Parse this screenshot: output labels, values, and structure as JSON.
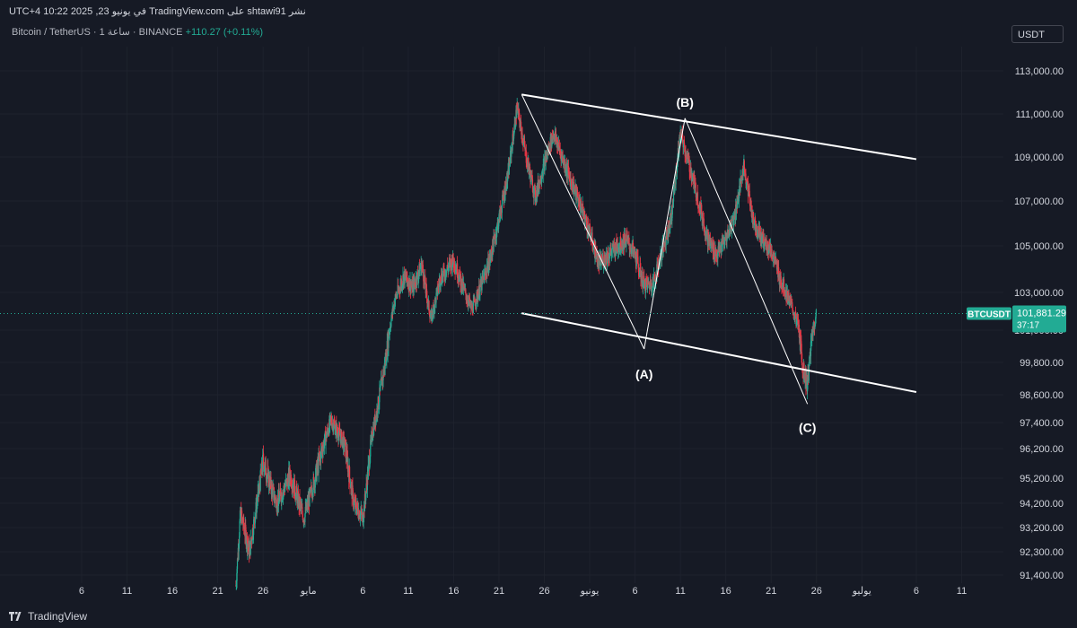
{
  "header": {
    "publisher_line": "نشر shtawi91 على TradingView.com في يونيو 23, 2025 10:22 UTC+4",
    "symbol": "Bitcoin / TetherUS · 1 ساعة · BINANCE",
    "change": "+110.27 (+0.11%)",
    "currency_button": "USDT"
  },
  "footer": {
    "brand": "TradingView"
  },
  "colors": {
    "background": "#161a25",
    "up": "#22ab94",
    "down": "#f23645",
    "price_tag": "#22ab94",
    "annotation": "#ffffff"
  },
  "chart_data": {
    "type": "candlestick",
    "symbol": "BTCUSDT",
    "last_price": "101,881.29",
    "countdown": "37:17",
    "ylim": [
      90800,
      114600
    ],
    "y_ticks": [
      "113,000.00",
      "111,000.00",
      "109,000.00",
      "107,000.00",
      "105,000.00",
      "103,000.00",
      "101,000.00",
      "99,800.00",
      "98,600.00",
      "97,400.00",
      "96,200.00",
      "95,200.00",
      "94,200.00",
      "93,200.00",
      "92,300.00",
      "91,400.00"
    ],
    "y_tick_values": [
      113000,
      111000,
      109000,
      107000,
      105000,
      103000,
      101000,
      99800,
      98600,
      97400,
      96200,
      95200,
      94200,
      93200,
      92300,
      91400
    ],
    "x_ticks": [
      "6",
      "11",
      "16",
      "21",
      "26",
      "مايو",
      "6",
      "11",
      "16",
      "21",
      "26",
      "يونيو",
      "6",
      "11",
      "16",
      "21",
      "26",
      "يوليو",
      "6",
      "11"
    ],
    "x_tick_days": [
      6,
      11,
      16,
      21,
      26,
      31,
      37,
      42,
      47,
      52,
      57,
      62,
      67,
      72,
      77,
      82,
      87,
      92,
      98,
      103
    ],
    "note_x": "x values are days counted from April 1 (1 = April 1, 31 = May 1, 62 = June 1, 92 = July 1)",
    "price_path": [
      [
        23,
        91000
      ],
      [
        23.5,
        93800
      ],
      [
        24.5,
        92300
      ],
      [
        26,
        95800
      ],
      [
        27.5,
        94200
      ],
      [
        29,
        95300
      ],
      [
        30.5,
        93600
      ],
      [
        32.5,
        96200
      ],
      [
        33.5,
        97500
      ],
      [
        35,
        96400
      ],
      [
        36,
        94200
      ],
      [
        37,
        93600
      ],
      [
        38,
        96800
      ],
      [
        39.5,
        99900
      ],
      [
        40.5,
        102600
      ],
      [
        41.5,
        103700
      ],
      [
        42.5,
        103200
      ],
      [
        43.5,
        104200
      ],
      [
        44.5,
        101600
      ],
      [
        45.5,
        103600
      ],
      [
        47,
        104400
      ],
      [
        49,
        102100
      ],
      [
        51,
        104400
      ],
      [
        52,
        106200
      ],
      [
        53,
        108200
      ],
      [
        54,
        111300
      ],
      [
        55,
        109000
      ],
      [
        56,
        107200
      ],
      [
        57,
        108700
      ],
      [
        58,
        110100
      ],
      [
        59.5,
        108400
      ],
      [
        61,
        106800
      ],
      [
        62,
        105600
      ],
      [
        63,
        104200
      ],
      [
        64.5,
        104800
      ],
      [
        66,
        105300
      ],
      [
        67,
        104600
      ],
      [
        68,
        103300
      ],
      [
        69,
        103400
      ],
      [
        70,
        104800
      ],
      [
        71,
        106300
      ],
      [
        72,
        110100
      ],
      [
        73.5,
        107800
      ],
      [
        75,
        105300
      ],
      [
        76,
        104600
      ],
      [
        77,
        105300
      ],
      [
        78,
        106400
      ],
      [
        79,
        108600
      ],
      [
        80,
        106200
      ],
      [
        81,
        105300
      ],
      [
        82,
        104800
      ],
      [
        83,
        103600
      ],
      [
        84,
        102600
      ],
      [
        85,
        101200
      ],
      [
        85.5,
        99600
      ],
      [
        86,
        99000
      ],
      [
        86.5,
        100800
      ],
      [
        87,
        101900
      ]
    ],
    "lines": [
      {
        "name": "upper-channel",
        "from": [
          54.5,
          111900
        ],
        "to": [
          98,
          108900
        ]
      },
      {
        "name": "lower-channel",
        "from": [
          54.5,
          101900
        ],
        "to": [
          98,
          98700
        ]
      },
      {
        "name": "wave-line-1",
        "from": [
          54.5,
          111900
        ],
        "to": [
          68,
          100300
        ]
      },
      {
        "name": "wave-line-2",
        "from": [
          68,
          100300
        ],
        "to": [
          72.5,
          110800
        ]
      },
      {
        "name": "wave-line-3",
        "from": [
          72.5,
          110800
        ],
        "to": [
          86,
          98200
        ]
      }
    ],
    "labels": [
      {
        "text": "(A)",
        "x": 68,
        "y": 99800
      },
      {
        "text": "(B)",
        "x": 72.5,
        "y": 111000
      },
      {
        "text": "(C)",
        "x": 86,
        "y": 97700
      }
    ]
  }
}
